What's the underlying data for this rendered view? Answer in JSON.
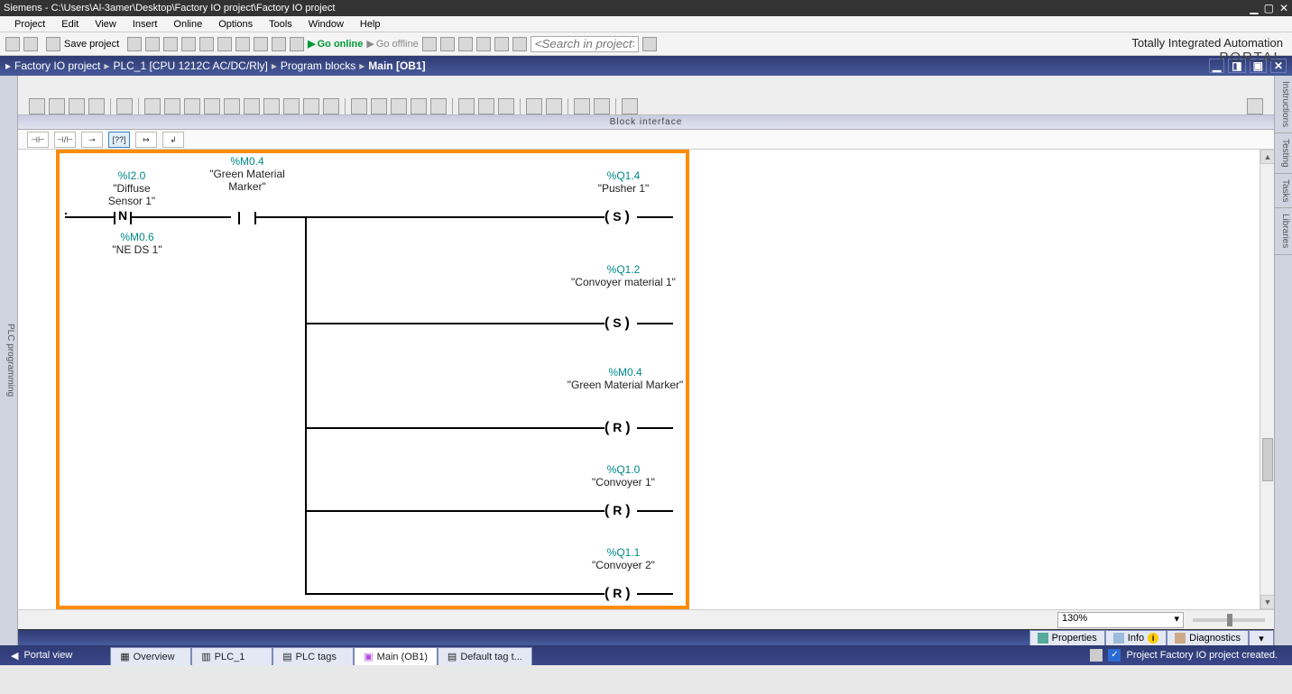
{
  "title": "Siemens  -  C:\\Users\\Al-3amer\\Desktop\\Factory IO project\\Factory IO project",
  "menu": [
    "Project",
    "Edit",
    "View",
    "Insert",
    "Online",
    "Options",
    "Tools",
    "Window",
    "Help"
  ],
  "toolbar": {
    "save_project": "Save project",
    "go_online": "Go online",
    "go_offline": "Go offline",
    "search_placeholder": "<Search in project>"
  },
  "brand": {
    "line1": "Totally Integrated Automation",
    "line2": "PORTAL"
  },
  "breadcrumb": {
    "items": [
      "Factory IO project",
      "PLC_1 [CPU 1212C AC/DC/Rly]",
      "Program blocks",
      "Main [OB1]"
    ],
    "sep": "▸"
  },
  "side_label": "PLC programming",
  "right_tabs": [
    "Instructions",
    "Testing",
    "Tasks",
    "Libraries"
  ],
  "block_interface": "Block interface",
  "ladder_toolbar": [
    "⊣⊢",
    "⊣/⊢",
    "⊸",
    "[??]",
    "↦",
    "↲"
  ],
  "ladder": {
    "in1": {
      "addr": "%I2.0",
      "label": "\"Diffuse Sensor 1\"",
      "edge_addr": "%M0.6",
      "edge_label": "\"NE DS 1\"",
      "sym": "N"
    },
    "in2": {
      "addr": "%M0.4",
      "label": "\"Green Material Marker\""
    },
    "out": [
      {
        "addr": "%Q1.4",
        "label": "\"Pusher 1\"",
        "sym": "S"
      },
      {
        "addr": "%Q1.2",
        "label": "\"Convoyer material 1\"",
        "sym": "S"
      },
      {
        "addr": "%M0.4",
        "label": "\"Green Material Marker\"",
        "sym": "R"
      },
      {
        "addr": "%Q1.0",
        "label": "\"Convoyer 1\"",
        "sym": "R"
      },
      {
        "addr": "%Q1.1",
        "label": "\"Convoyer 2\"",
        "sym": "R"
      }
    ]
  },
  "zoom": "130%",
  "footer_tabs": {
    "properties": "Properties",
    "info": "Info",
    "diagnostics": "Diagnostics"
  },
  "bottom": {
    "portal_view": "Portal view",
    "tabs": [
      "Overview",
      "PLC_1",
      "PLC tags",
      "Main (OB1)",
      "Default tag t..."
    ],
    "active_tab": 3,
    "status": "Project Factory IO project created."
  }
}
